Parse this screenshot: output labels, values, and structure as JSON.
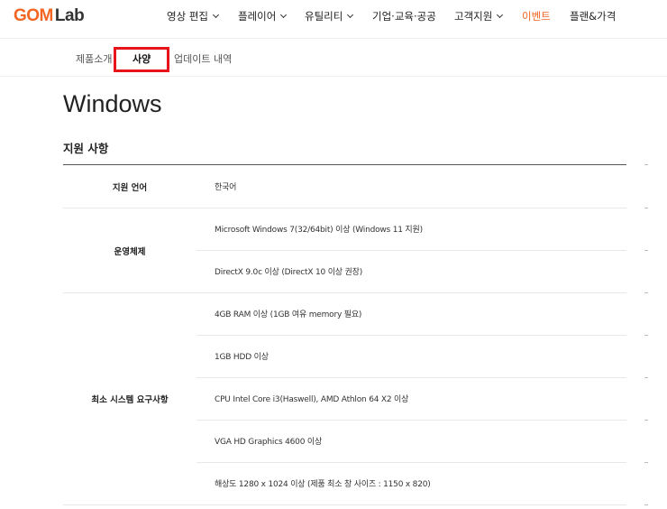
{
  "brand": {
    "gom": "GOM",
    "lab": "Lab",
    "accent": "#f26522"
  },
  "nav": {
    "items": [
      {
        "label": "영상 편집",
        "dropdown": true
      },
      {
        "label": "플레이어",
        "dropdown": true
      },
      {
        "label": "유틸리티",
        "dropdown": true
      },
      {
        "label": "기업·교육·공공",
        "dropdown": false
      },
      {
        "label": "고객지원",
        "dropdown": true
      },
      {
        "label": "이벤트",
        "dropdown": false,
        "active": true
      },
      {
        "label": "플랜&가격",
        "dropdown": false
      }
    ]
  },
  "subtabs": {
    "intro": "제품소개",
    "spec": "사양",
    "updates": "업데이트 내역",
    "highlight_color": "#e8141b"
  },
  "page": {
    "title": "Windows",
    "section": "지원 사항"
  },
  "spec_table": {
    "language": {
      "label": "지원 언어",
      "value": "한국어"
    },
    "os": {
      "label": "운영체제",
      "values": [
        "Microsoft Windows 7(32/64bit) 이상 (Windows 11 지원)",
        "DirectX 9.0c 이상 (DirectX 10 이상 권장)"
      ]
    },
    "minimum": {
      "label": "최소 시스템 요구사항",
      "values": [
        "4GB RAM 이상 (1GB 여유 memory 필요)",
        "1GB HDD 이상",
        "CPU Intel Core i3(Haswell), AMD Athlon 64 X2 이상",
        "VGA HD Graphics 4600 이상",
        "해상도 1280 x 1024 이상 (제품 최소 창 사이즈 : 1150 x 820)"
      ]
    }
  }
}
